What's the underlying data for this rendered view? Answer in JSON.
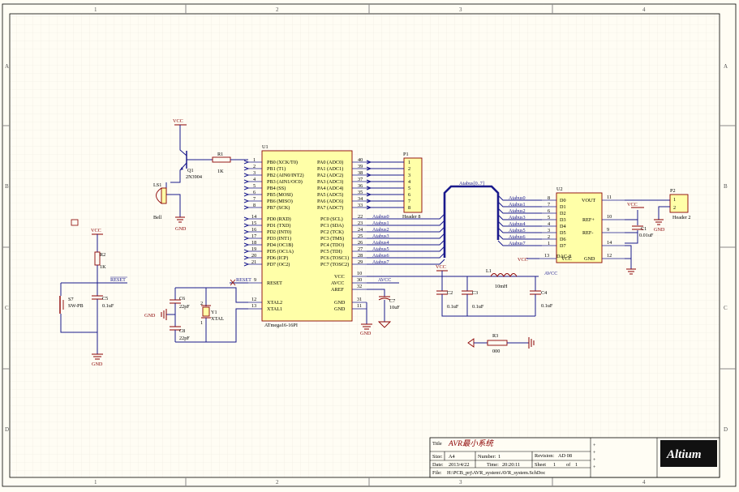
{
  "border": {
    "columns": [
      "1",
      "2",
      "3",
      "4"
    ],
    "rows": [
      "A",
      "B",
      "C",
      "D"
    ]
  },
  "u1": {
    "designator": "U1",
    "part": "ATmega16-16PI",
    "left_pins_b": [
      "PB0 (XCK/T0)",
      "PB1 (T1)",
      "PB2 (AIN0/INT2)",
      "PB3 (AIN1/OC0)",
      "PB4 (SS)",
      "PB5 (MOSI)",
      "PB6 (MISO)",
      "PB7 (SCK)"
    ],
    "left_pins_d": [
      "PD0 (RXD)",
      "PD1 (TXD)",
      "PD2 (INT0)",
      "PD3 (INT1)",
      "PD4 (OC1B)",
      "PD5 (OC1A)",
      "PD6 (ICP)",
      "PD7 (OC2)"
    ],
    "right_pins_a": [
      "PA0 (ADC0)",
      "PA1 (ADC1)",
      "PA2 (ADC2)",
      "PA3 (ADC3)",
      "PA4 (ADC4)",
      "PA5 (ADC5)",
      "PA6 (ADC6)",
      "PA7 (ADC7)"
    ],
    "right_pins_c": [
      "PC0 (SCL)",
      "PC1 (SDA)",
      "PC2 (TCK)",
      "PC3 (TMS)",
      "PC4 (TDO)",
      "PC5 (TDI)",
      "PC6 (TOSC1)",
      "PC7 (TOSC2)"
    ],
    "pin_nums_left_b": [
      "1",
      "2",
      "3",
      "4",
      "5",
      "6",
      "7",
      "8"
    ],
    "pin_nums_left_d": [
      "14",
      "15",
      "16",
      "17",
      "18",
      "19",
      "20",
      "21"
    ],
    "pin_nums_right_a": [
      "40",
      "39",
      "38",
      "37",
      "36",
      "35",
      "34",
      "33"
    ],
    "pin_nums_right_c": [
      "22",
      "23",
      "24",
      "25",
      "26",
      "27",
      "28",
      "29"
    ],
    "reset": "RESET",
    "reset_num": "9",
    "xtal2": "XTAL2",
    "xtal1": "XTAL1",
    "xtal2_num": "12",
    "xtal1_num": "13",
    "vcc": "VCC",
    "avcc": "AVCC",
    "aref": "AREF",
    "gnd1": "GND",
    "gnd2": "GND",
    "vcc_num": "10",
    "avcc_num": "30",
    "aref_num": "32",
    "gnd1_num": "31",
    "gnd2_num": "11"
  },
  "p1": {
    "designator": "P1",
    "name": "Header 8",
    "pins": [
      "1",
      "2",
      "3",
      "4",
      "5",
      "6",
      "7",
      "8"
    ]
  },
  "bus": {
    "name": "Atabus[0..7]",
    "c_labels": [
      "Atabus0",
      "Atabus1",
      "Atabus2",
      "Atabus3",
      "Atabus4",
      "Atabus5",
      "Atabus6",
      "Atabus7"
    ],
    "dac_labels": [
      "Atabus0",
      "Atabus1",
      "Atabus2",
      "Atabus3",
      "Atabus4",
      "Atabus5",
      "Atabus6",
      "Atabus7"
    ]
  },
  "u2": {
    "designator": "U2",
    "part": "DAC-8",
    "inputs": [
      "D0",
      "D1",
      "D2",
      "D3",
      "D4",
      "D5",
      "D6",
      "D7"
    ],
    "input_nums": [
      "8",
      "7",
      "6",
      "5",
      "4",
      "3",
      "2",
      "1"
    ],
    "vout": "VOUT",
    "vout_num": "11",
    "refp": "REF+",
    "refp_num": "10",
    "refm": "REF-",
    "refm_num": "9",
    "vcc": "VCC",
    "vcc_num": "13",
    "gnd": "GND",
    "gnd_num": "12",
    "pin14": "14"
  },
  "p2": {
    "designator": "P2",
    "name": "Header 2",
    "pins": [
      "1",
      "2"
    ]
  },
  "nets": {
    "vcc": "VCC",
    "gnd": "GND",
    "avcc": "AVCC",
    "reset": "RESET"
  },
  "parts": {
    "q1": {
      "designator": "Q1",
      "value": "2N3904"
    },
    "r1": {
      "designator": "R1",
      "value": "1K"
    },
    "ls1": {
      "designator": "LS1",
      "value": "Bell"
    },
    "r2": {
      "designator": "R2",
      "value": "1K"
    },
    "c5": {
      "designator": "C5",
      "value": "0.1uF"
    },
    "s7": {
      "designator": "S7",
      "value": "SW-PB"
    },
    "c6": {
      "designator": "C6",
      "value": "22pF"
    },
    "c8": {
      "designator": "C8",
      "value": "22pF"
    },
    "y1": {
      "designator": "Y1",
      "value": "XTAL",
      "pin1": "1",
      "pin2": "2"
    },
    "c7": {
      "designator": "C7",
      "value": "10uF"
    },
    "c2": {
      "designator": "C2",
      "value": "0.1uF"
    },
    "c3": {
      "designator": "C3",
      "value": "0.1uF"
    },
    "l1": {
      "designator": "L1",
      "value": "10mH"
    },
    "c4": {
      "designator": "C4",
      "value": "0.1uF"
    },
    "c1": {
      "designator": "C1",
      "value": "0.01uF"
    },
    "r3": {
      "designator": "R3",
      "value": "000"
    }
  },
  "title_block": {
    "title_label": "Title",
    "title": "AVR最小系统",
    "size_label": "Size:",
    "size": "A4",
    "number_label": "Number:",
    "number": "1",
    "revision_label": "Revision:",
    "revision": "AD 08",
    "date_label": "Date:",
    "date": "2013/4/22",
    "time_label": "Time:",
    "time": "20:20:11",
    "sheet_label": "Sheet",
    "sheet": "1",
    "of_label": "of",
    "of": "1",
    "file_label": "File:",
    "file": "H:\\PCB_prj\\AVR_system\\AVR_system.SchDoc",
    "logo": "Altium"
  }
}
